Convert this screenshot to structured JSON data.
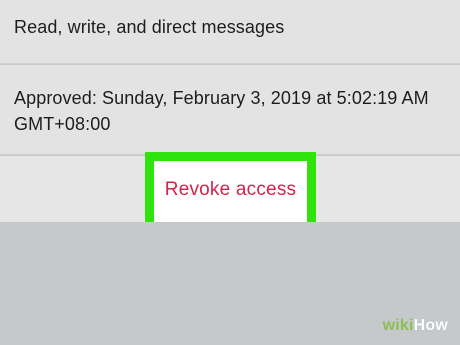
{
  "app_permissions": {
    "permissions_text": "Read, write, and direct messages",
    "approved_text": "Approved: Sunday, February 3, 2019 at 5:02:19 AM GMT+08:00",
    "revoke_label": "Revoke access"
  },
  "watermark": {
    "part1": "wiki",
    "part2": "How"
  },
  "colors": {
    "highlight": "#2fe40d",
    "revoke_text": "#d5224a",
    "row_background": "#e3e3e3",
    "page_background": "#c5c9cb"
  }
}
